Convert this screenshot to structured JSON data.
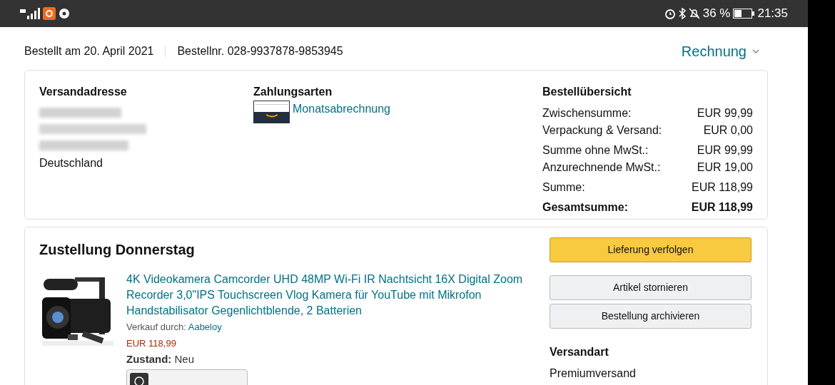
{
  "status_bar": {
    "battery": "36 %",
    "time": "21:35"
  },
  "order": {
    "date": "Bestellt am 20. April 2021",
    "number": "Bestellnr. 028-9937878-9853945",
    "invoice": "Rechnung"
  },
  "shipping": {
    "title": "Versandadresse",
    "country": "Deutschland"
  },
  "payment": {
    "title": "Zahlungsarten",
    "method": "Monatsabrechnung"
  },
  "summary": {
    "title": "Bestellübersicht",
    "rows": [
      {
        "label": "Zwischensumme:",
        "value": "EUR 99,99",
        "bold": false
      },
      {
        "label": "Verpackung & Versand:",
        "value": "EUR 0,00",
        "bold": false
      },
      {
        "label": "Summe ohne MwSt.:",
        "value": "EUR 99,99",
        "bold": false
      },
      {
        "label": "Anzurechnende MwSt.:",
        "value": "EUR 19,00",
        "bold": false
      },
      {
        "label": "Summe:",
        "value": "EUR 118,99",
        "bold": false
      },
      {
        "label": "Gesamtsumme:",
        "value": "EUR 118,99",
        "bold": true
      }
    ]
  },
  "delivery": {
    "title": "Zustellung Donnerstag",
    "product": {
      "title": "4K Videokamera Camcorder UHD 48MP Wi-Fi IR Nachtsicht 16X Digital Zoom Recorder 3,0\"IPS Touchscreen Vlog Kamera für YouTube mit Mikrofon Handstabilisator Gegenlichtblende, 2 Batterien",
      "seller_label": "Verkauf durch:",
      "seller": "Aabeloy",
      "price": "EUR 118,99",
      "condition_label": "Zustand:",
      "condition": "Neu"
    },
    "actions": [
      {
        "label": "Lieferung verfolgen",
        "kind": "primary"
      },
      {
        "label": "Artikel stornieren",
        "kind": "secondary"
      },
      {
        "label": "Bestellung archivieren",
        "kind": "secondary"
      }
    ],
    "shipping_method_title": "Versandart",
    "shipping_method": "Premiumversand"
  }
}
